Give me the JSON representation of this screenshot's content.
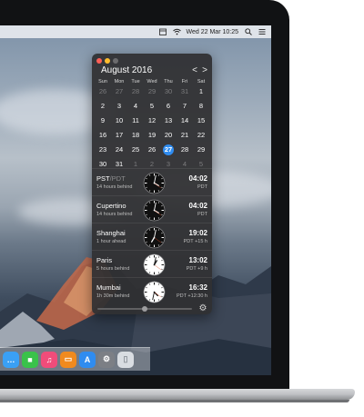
{
  "menubar": {
    "datetime": "Wed 22 Mar 10:25",
    "icons": [
      "calendar-icon",
      "wifi-icon",
      "spotlight-icon",
      "notification-center-icon"
    ]
  },
  "calendar": {
    "title": "August 2016",
    "prev_label": "<",
    "next_label": ">",
    "weekdays": [
      "Sun",
      "Mon",
      "Tue",
      "Wed",
      "Thu",
      "Fri",
      "Sat"
    ],
    "weeks": [
      [
        {
          "d": "26",
          "dim": true
        },
        {
          "d": "27",
          "dim": true
        },
        {
          "d": "28",
          "dim": true
        },
        {
          "d": "29",
          "dim": true
        },
        {
          "d": "30",
          "dim": true
        },
        {
          "d": "31",
          "dim": true
        },
        {
          "d": "1",
          "dim": false
        }
      ],
      [
        {
          "d": "2",
          "dim": false
        },
        {
          "d": "3",
          "dim": false
        },
        {
          "d": "4",
          "dim": false
        },
        {
          "d": "5",
          "dim": false
        },
        {
          "d": "6",
          "dim": false
        },
        {
          "d": "7",
          "dim": false
        },
        {
          "d": "8",
          "dim": false
        }
      ],
      [
        {
          "d": "9",
          "dim": false
        },
        {
          "d": "10",
          "dim": false
        },
        {
          "d": "11",
          "dim": false
        },
        {
          "d": "12",
          "dim": false
        },
        {
          "d": "13",
          "dim": false
        },
        {
          "d": "14",
          "dim": false
        },
        {
          "d": "15",
          "dim": false
        }
      ],
      [
        {
          "d": "16",
          "dim": false
        },
        {
          "d": "17",
          "dim": false
        },
        {
          "d": "18",
          "dim": false
        },
        {
          "d": "19",
          "dim": false
        },
        {
          "d": "20",
          "dim": false
        },
        {
          "d": "21",
          "dim": false
        },
        {
          "d": "22",
          "dim": false
        }
      ],
      [
        {
          "d": "23",
          "dim": false
        },
        {
          "d": "24",
          "dim": false
        },
        {
          "d": "25",
          "dim": false
        },
        {
          "d": "26",
          "dim": false
        },
        {
          "d": "27",
          "dim": false,
          "today": true
        },
        {
          "d": "28",
          "dim": false
        },
        {
          "d": "29",
          "dim": false
        }
      ],
      [
        {
          "d": "30",
          "dim": false
        },
        {
          "d": "31",
          "dim": false
        },
        {
          "d": "1",
          "dim": true
        },
        {
          "d": "2",
          "dim": true
        },
        {
          "d": "3",
          "dim": true
        },
        {
          "d": "4",
          "dim": true
        },
        {
          "d": "5",
          "dim": true
        }
      ]
    ],
    "today_color": "#2f8cf0"
  },
  "clocks": [
    {
      "city": "PST",
      "city_alt": "/PDT",
      "diff": "14 hours behind",
      "time": "04:02",
      "tz": "PDT",
      "hour": 4,
      "minute": 2,
      "night": true
    },
    {
      "city": "Cupertino",
      "city_alt": "",
      "diff": "14 hours behind",
      "time": "04:02",
      "tz": "PDT",
      "hour": 4,
      "minute": 2,
      "night": true
    },
    {
      "city": "Shanghai",
      "city_alt": "",
      "diff": "1 hour ahead",
      "time": "19:02",
      "tz": "PDT +15 h",
      "hour": 19,
      "minute": 2,
      "night": true
    },
    {
      "city": "Paris",
      "city_alt": "",
      "diff": "5 hours behind",
      "time": "13:02",
      "tz": "PDT +9 h",
      "hour": 13,
      "minute": 2,
      "night": false
    },
    {
      "city": "Mumbai",
      "city_alt": "",
      "diff": "1h 30m behind",
      "time": "16:32",
      "tz": "PDT +12:30 h",
      "hour": 16,
      "minute": 32,
      "night": false
    }
  ],
  "footer": {
    "time_slider_position": 0.5
  },
  "dock": {
    "apps": [
      {
        "icon": "messages-icon",
        "color": "#3aa0f5",
        "glyph": "…"
      },
      {
        "icon": "facetime-icon",
        "color": "#3ac24a",
        "glyph": "■"
      },
      {
        "icon": "itunes-icon",
        "color": "#f04c7a",
        "glyph": "♫"
      },
      {
        "icon": "ibooks-icon",
        "color": "#f08a1e",
        "glyph": "▭"
      },
      {
        "icon": "app-store-icon",
        "color": "#2f8cf0",
        "glyph": "A"
      },
      {
        "icon": "system-preferences-icon",
        "color": "#7c7f85",
        "glyph": "⚙"
      },
      {
        "icon": "trash-icon",
        "color": "#d9dde2",
        "glyph": "▯"
      }
    ]
  }
}
